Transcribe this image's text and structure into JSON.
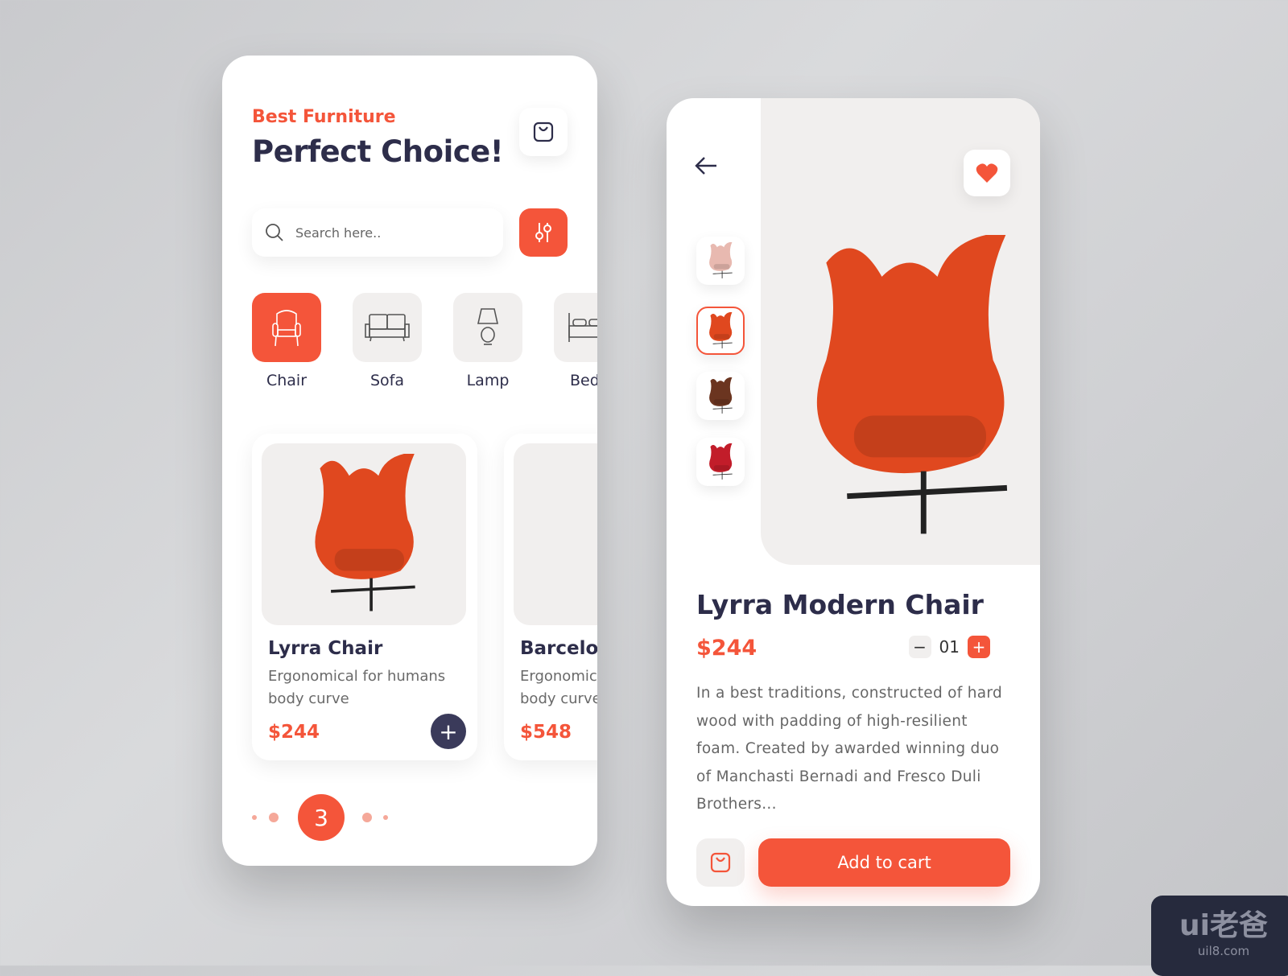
{
  "home": {
    "subtitle": "Best Furniture",
    "title": "Perfect Choice!",
    "search_placeholder": "Search here..",
    "categories": [
      {
        "label": "Chair",
        "icon": "armchair-icon",
        "active": true
      },
      {
        "label": "Sofa",
        "icon": "sofa-icon"
      },
      {
        "label": "Lamp",
        "icon": "lamp-icon"
      },
      {
        "label": "Bed",
        "icon": "bed-icon"
      }
    ],
    "products": [
      {
        "name": "Lyrra Chair",
        "desc": "Ergonomical for humans body curve",
        "price": "$244"
      },
      {
        "name": "Barcelona",
        "desc": "Ergonomical for humans body curve",
        "price": "$548"
      }
    ],
    "current_page": "3"
  },
  "detail": {
    "name": "Lyrra Modern Chair",
    "price": "$244",
    "quantity": "01",
    "description": "In a best traditions, constructed of hard wood with padding of high-resilient foam. Created by awarded winning duo of Manchasti Bernadi and Fresco Duli Brothers...",
    "add_to_cart": "Add to cart",
    "thumb_colors": [
      "#e8b9b0",
      "#e0481f",
      "#6b3520",
      "#c21d2a"
    ]
  },
  "watermark": {
    "logo": "ui老爸",
    "site": "uil8.com"
  },
  "colors": {
    "accent": "#f4553a",
    "dark": "#2d2d4a"
  }
}
